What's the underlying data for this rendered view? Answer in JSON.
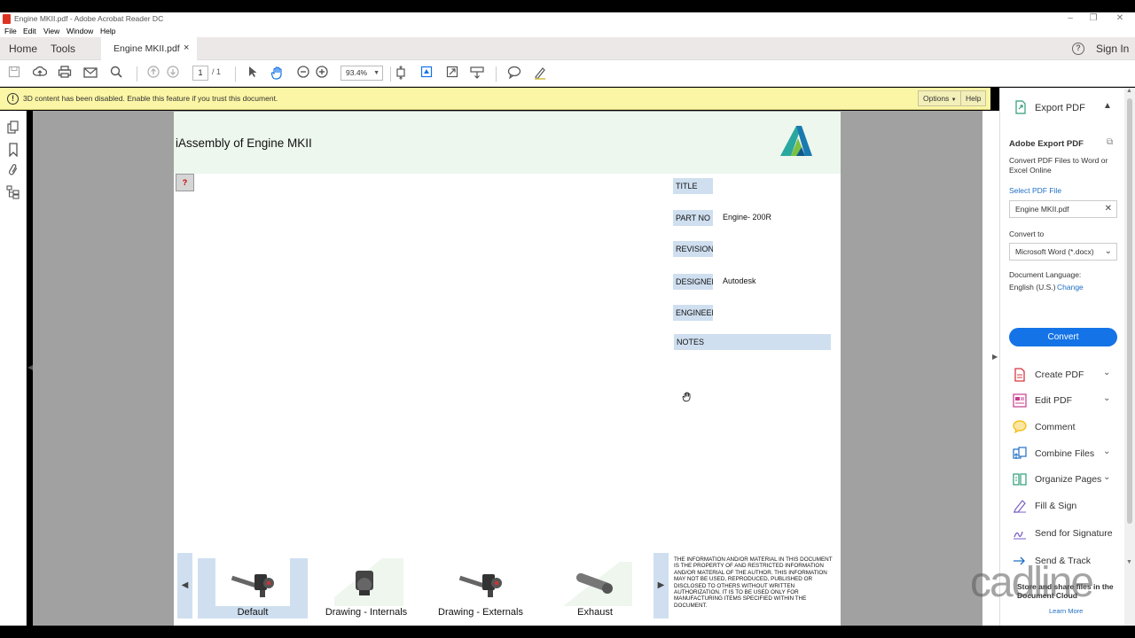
{
  "window": {
    "title": "Engine MKII.pdf - Adobe Acrobat Reader DC",
    "minimize": "–",
    "maximize": "❐",
    "close": "✕"
  },
  "menu": [
    "File",
    "Edit",
    "View",
    "Window",
    "Help"
  ],
  "tabs": {
    "home": "Home",
    "tools": "Tools",
    "document": "Engine MKII.pdf",
    "close": "×",
    "help": "?",
    "signin": "Sign In"
  },
  "toolbar": {
    "page_current": "1",
    "page_total": "/ 1",
    "zoom": "93.4%",
    "icons": [
      "save-icon",
      "upload-icon",
      "print-icon",
      "email-icon",
      "search-icon",
      "page-up-icon",
      "page-down-icon",
      "select-cursor-icon",
      "hand-tool-icon",
      "zoom-out-icon",
      "zoom-in-icon",
      "fit-page-icon",
      "rotate-icon",
      "fullscreen-icon",
      "scroll-mode-icon",
      "comment-icon",
      "highlight-pen-icon"
    ]
  },
  "notification": {
    "message": "3D content has been disabled. Enable this feature if you trust this document.",
    "options_label": "Options",
    "help_label": "Help",
    "warn": "!"
  },
  "document": {
    "title": "iAssembly of Engine MKII",
    "qmark": "?",
    "fields": [
      {
        "label": "TITLE",
        "value": ""
      },
      {
        "label": "PART NO",
        "value": "Engine- 200R"
      },
      {
        "label": "REVISION",
        "value": ""
      },
      {
        "label": "DESIGNER",
        "value": "Autodesk"
      },
      {
        "label": "ENGINEER",
        "value": ""
      }
    ],
    "notes_label": "NOTES",
    "thumbnails": [
      "Default",
      "Drawing - Internals",
      "Drawing - Externals",
      "Exhaust"
    ],
    "strip_prev": "◀",
    "strip_next": "▶",
    "disclaimer": "THE INFORMATION AND/OR MATERIAL IN THIS DOCUMENT IS THE PROPERTY OF AND RESTRICTED INFORMATION AND/OR MATERIAL OF THE AUTHOR. THIS INFORMATION MAY NOT BE USED, REPRODUCED, PUBLISHED OR DISCLOSED TO OTHERS WITHOUT WRITTEN AUTHORIZATION. IT IS TO BE USED ONLY FOR MANUFACTURING ITEMS SPECIFIED WITHIN THE DOCUMENT."
  },
  "right_pane": {
    "export_pdf": "Export PDF",
    "adobe_export_title": "Adobe Export PDF",
    "export_desc": "Convert PDF Files to Word or Excel Online",
    "select_file_link": "Select PDF File",
    "selected_file": "Engine MKII.pdf",
    "convert_to_label": "Convert to",
    "convert_to_value": "Microsoft Word (*.docx)",
    "doc_language_label": "Document Language:",
    "doc_language_value": "English (U.S.)",
    "change_link": "Change",
    "convert_button": "Convert",
    "tools": [
      {
        "label": "Create PDF",
        "icon": "create-pdf-icon",
        "color": "#d7373f",
        "chevron": true
      },
      {
        "label": "Edit PDF",
        "icon": "edit-pdf-icon",
        "color": "#c93c8c",
        "chevron": true
      },
      {
        "label": "Comment",
        "icon": "comment-icon",
        "color": "#f5b700",
        "chevron": false
      },
      {
        "label": "Combine Files",
        "icon": "combine-files-icon",
        "color": "#1e6fc4",
        "chevron": true
      },
      {
        "label": "Organize Pages",
        "icon": "organize-pages-icon",
        "color": "#2d9d78",
        "chevron": true
      },
      {
        "label": "Fill & Sign",
        "icon": "fill-sign-icon",
        "color": "#7a5fc4",
        "chevron": false
      },
      {
        "label": "Send for Signature",
        "icon": "send-signature-icon",
        "color": "#7a5fc4",
        "chevron": false
      },
      {
        "label": "Send & Track",
        "icon": "send-track-icon",
        "color": "#1e6fc4",
        "chevron": false
      }
    ]
  },
  "watermark": {
    "brand": "cadline",
    "cloud_text": "Store and share files in the Document Cloud",
    "learn_more": "Learn More"
  },
  "colors": {
    "accent": "#1473e6",
    "notification_bg": "#fbf6a5",
    "field_bg": "#cfdff0",
    "page_header_bg": "#edf7ee"
  }
}
